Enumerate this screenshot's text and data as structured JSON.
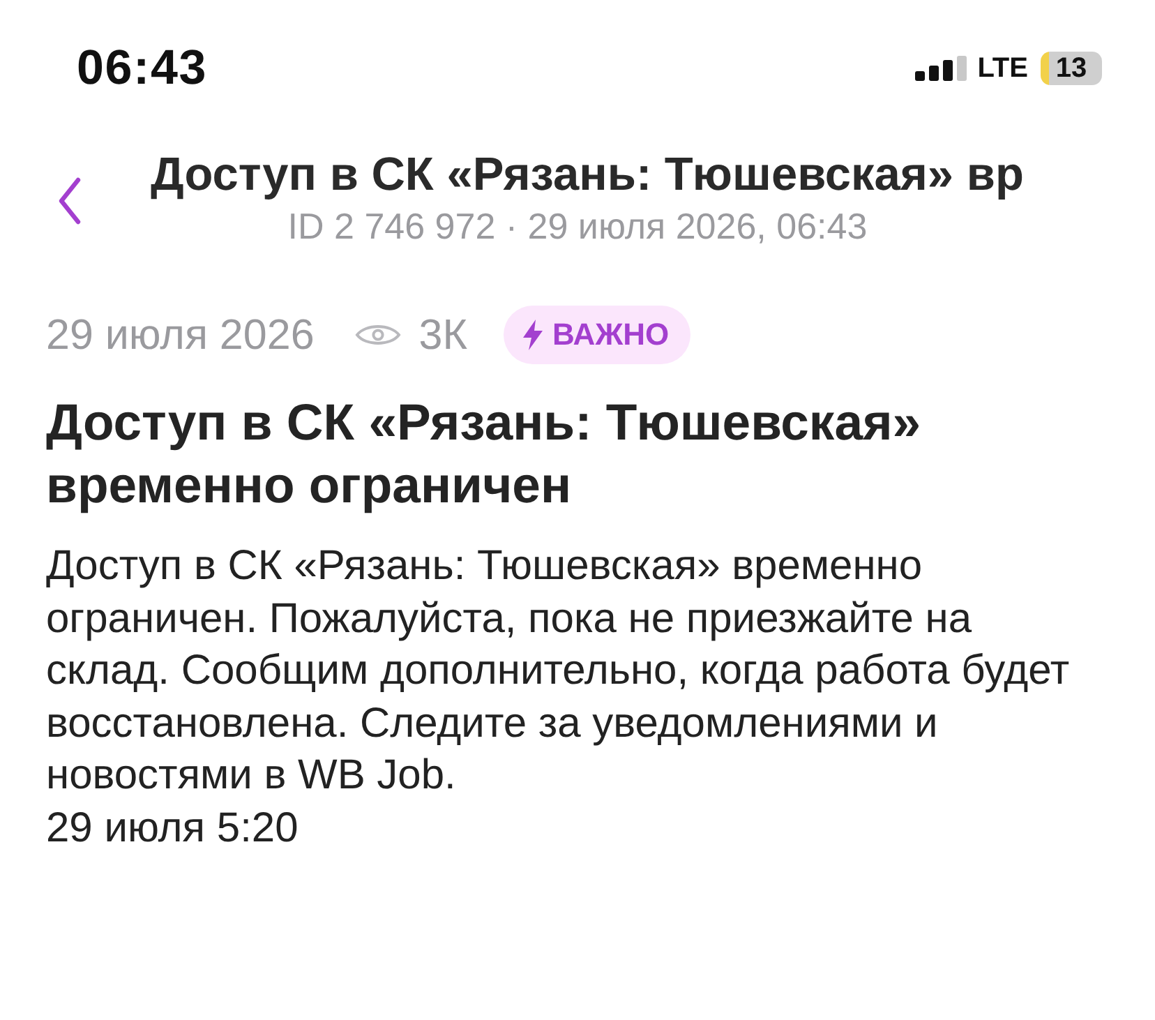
{
  "status_bar": {
    "time": "06:43",
    "network": "LTE",
    "battery": "13"
  },
  "header": {
    "title": "Доступ в СК «Рязань: Тюшевская» вр",
    "subtitle": "ID 2 746 972 · 29 июля 2026, 06:43"
  },
  "article": {
    "date": "29 июля 2026",
    "views": "3К",
    "badge": {
      "label": "ВАЖНО"
    },
    "title": "Доступ в СК «Рязань: Тюшевская» временно ограничен",
    "body": "Доступ в СК «Рязань: Тюшевская» временно ограничен. Пожалуйста, пока не приезжайте на склад. Сообщим дополнительно, когда работа будет восстановлена. Следите за уведомлениями и новостями в WB Job.",
    "timestamp": "29 июля 5:20"
  }
}
